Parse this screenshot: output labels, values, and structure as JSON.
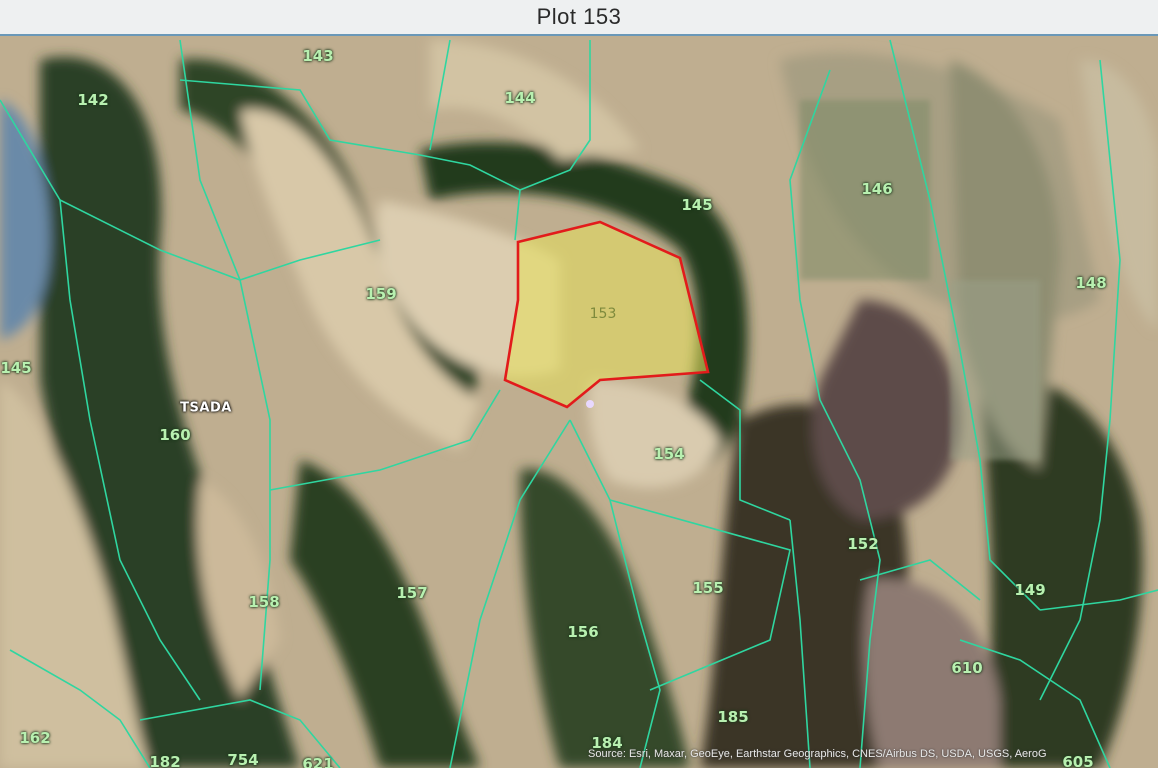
{
  "window": {
    "title": "Plot 153"
  },
  "map": {
    "selected_plot": "153",
    "place_label": "TSADA",
    "plot_labels": [
      "142",
      "143",
      "144",
      "145",
      "145",
      "146",
      "148",
      "149",
      "152",
      "153",
      "154",
      "155",
      "156",
      "157",
      "158",
      "159",
      "160",
      "162",
      "182",
      "184",
      "185",
      "610",
      "754",
      "621",
      "605"
    ],
    "attribution": "Source: Esri, Maxar, GeoEye, Earthstar Geographics, CNES/Airbus DS, USDA, USGS, AeroG"
  },
  "colors": {
    "parcel_line": "#2fd6a0",
    "selection_outline": "#e21b1b",
    "selection_fill": "#e6e05a"
  }
}
